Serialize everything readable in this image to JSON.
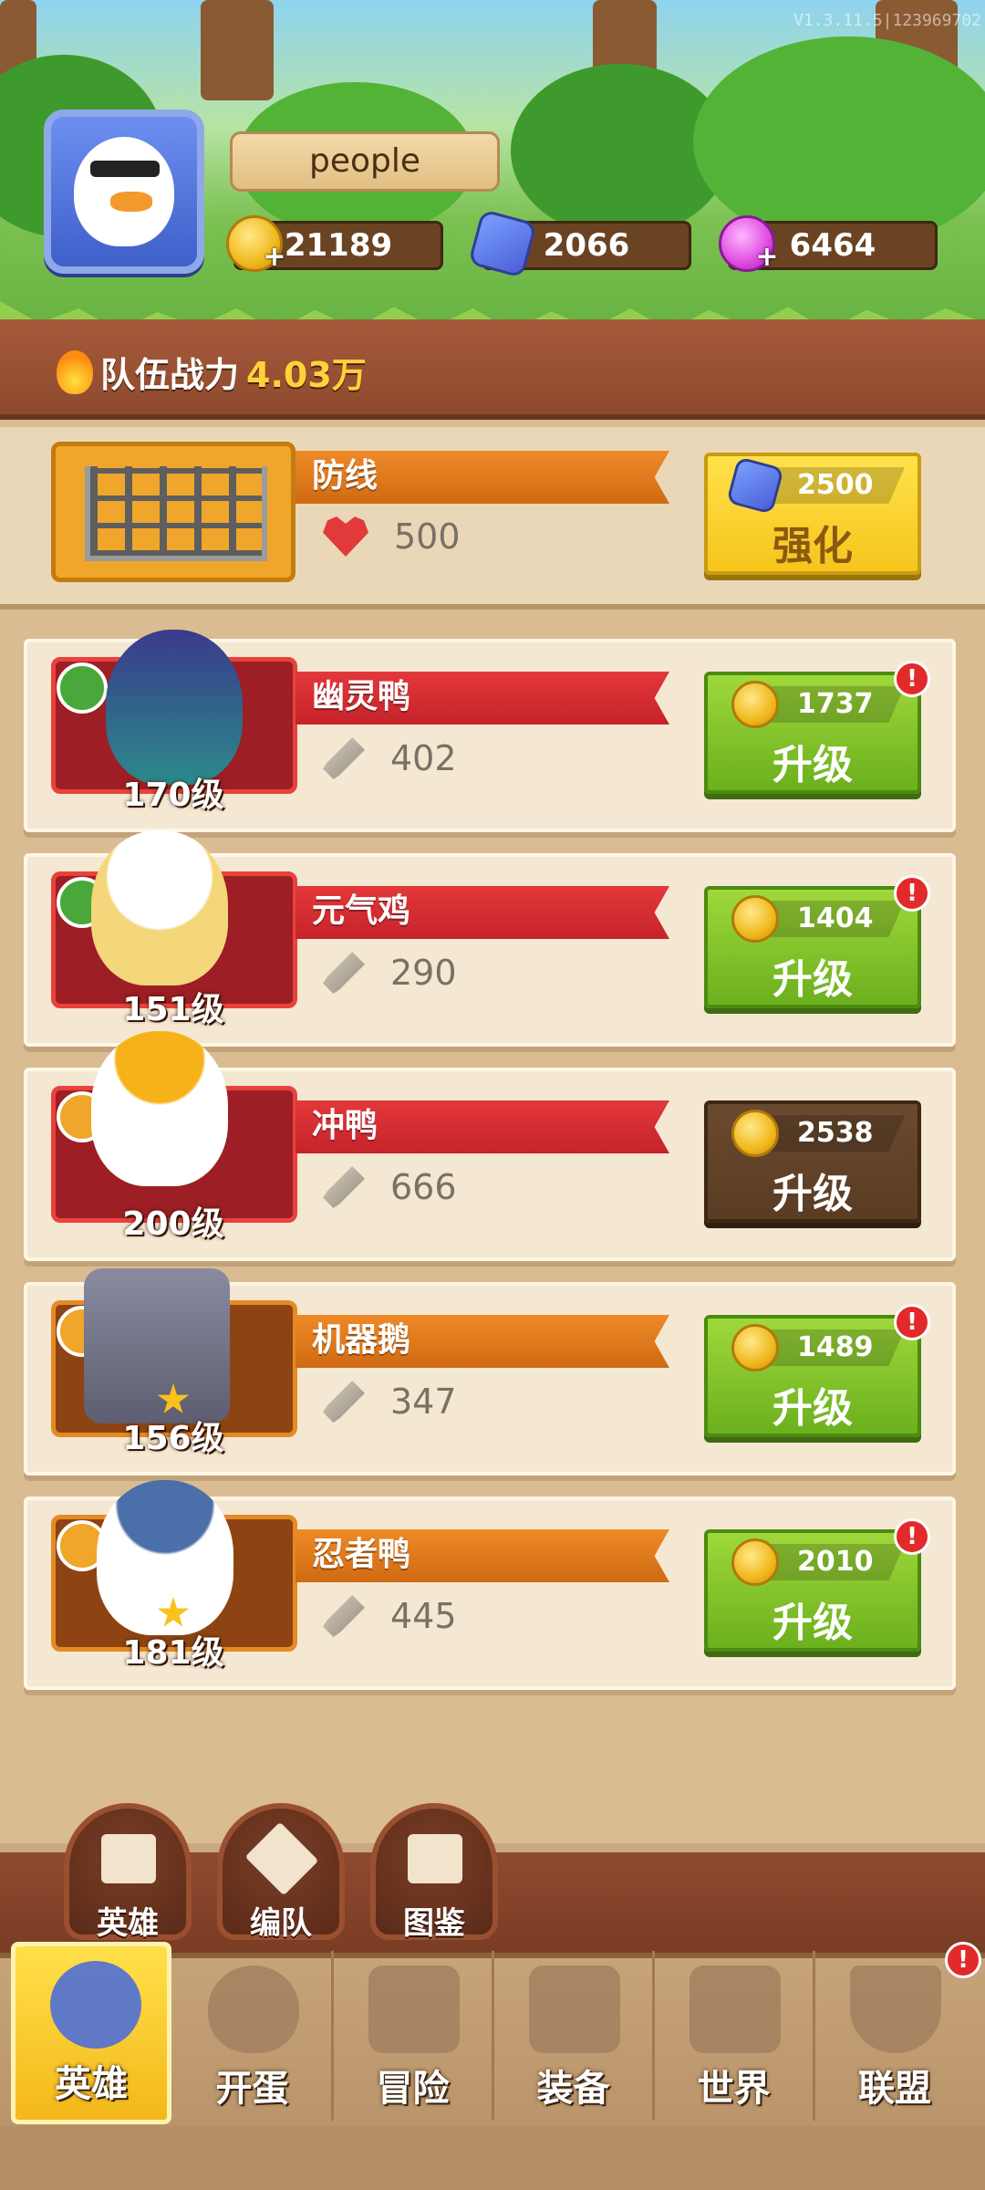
{
  "header": {
    "version": "V1.3.11.5|123969702",
    "player_name": "people",
    "resources": {
      "coins": "21189",
      "gems": "2066",
      "diamonds": "6464"
    },
    "team_power_label": "队伍战力",
    "team_power_value": "4.03万"
  },
  "defense": {
    "name": "防线",
    "hp": "500",
    "upgrade_cost": "2500",
    "upgrade_label": "强化"
  },
  "heroes": [
    {
      "name": "幽灵鸭",
      "level": "170级",
      "attack": "402",
      "cost": "1737",
      "action": "升级",
      "alert": "!"
    },
    {
      "name": "元气鸡",
      "level": "151级",
      "attack": "290",
      "cost": "1404",
      "action": "升级",
      "alert": "!"
    },
    {
      "name": "冲鸭",
      "level": "200级",
      "attack": "666",
      "cost": "2538",
      "action": "升级",
      "alert": ""
    },
    {
      "name": "机器鹅",
      "level": "156级",
      "attack": "347",
      "cost": "1489",
      "action": "升级",
      "alert": "!"
    },
    {
      "name": "忍者鸭",
      "level": "181级",
      "attack": "445",
      "cost": "2010",
      "action": "升级",
      "alert": "!"
    }
  ],
  "sub_tabs": [
    "英雄",
    "编队",
    "图鉴"
  ],
  "bottom_nav": [
    {
      "label": "英雄",
      "icon": "hero-duck-icon"
    },
    {
      "label": "开蛋",
      "icon": "egg-icon"
    },
    {
      "label": "冒险",
      "icon": "crossed-swords-icon"
    },
    {
      "label": "装备",
      "icon": "anvil-icon"
    },
    {
      "label": "世界",
      "icon": "map-icon"
    },
    {
      "label": "联盟",
      "icon": "shield-icon"
    }
  ],
  "nav_alert": "!",
  "colors": {
    "green_button": "#7bc42a",
    "yellow_button": "#f6c51c",
    "brown_button": "#5a3c24",
    "red_banner": "#d52d31",
    "orange_banner": "#e07a1c"
  }
}
